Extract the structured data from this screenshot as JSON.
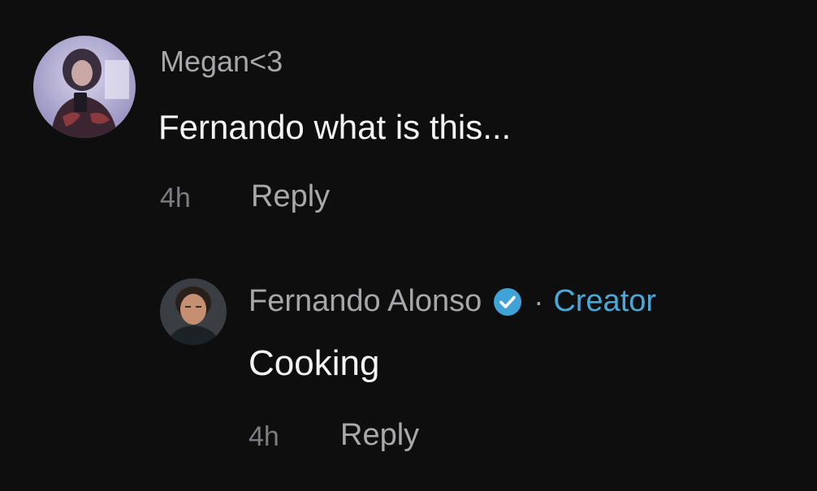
{
  "comments": [
    {
      "username": "Megan<3",
      "text": "Fernando what is this...",
      "timestamp": "4h",
      "reply_label": "Reply",
      "avatar_icon": "user-avatar-photo"
    },
    {
      "username": "Fernando Alonso",
      "verified": true,
      "separator": "·",
      "role": "Creator",
      "text": "Cooking",
      "timestamp": "4h",
      "reply_label": "Reply",
      "avatar_icon": "user-avatar-photo"
    }
  ],
  "colors": {
    "background": "#0e0e0f",
    "creator_accent": "#4aa8d8",
    "verified_badge": "#3fa3d6"
  }
}
